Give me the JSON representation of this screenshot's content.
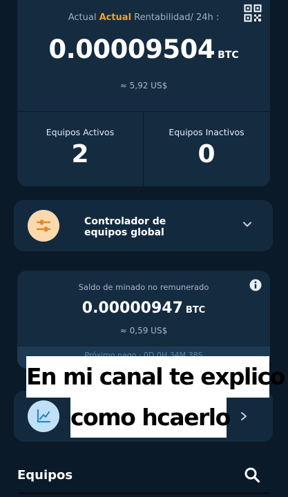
{
  "top": {
    "rent_prefix": "Actual ",
    "rent_accent": "Actual",
    "rent_suffix": " Rentabilidad/ 24h :",
    "balance": "0.00009504",
    "unit": "BTC",
    "usd": "≈ 5,92 US$",
    "active_label": "Equipos Activos",
    "active_count": "2",
    "inactive_label": "Equipos Inactivos",
    "inactive_count": "0"
  },
  "controller": {
    "label": "Controlador de equipos global"
  },
  "mining": {
    "label": "Saldo de minado no remunerado",
    "value": "0.00000947",
    "unit": "BTC",
    "usd": "≈ 0,59 US$",
    "footer": "Próximo pago · 0D 0H 34M 38S"
  },
  "caption": {
    "line1": "En mi canal te explico",
    "line2": "como hcaerlo"
  },
  "bottom": {
    "title": "Equipos"
  },
  "colors": {
    "background": "#0b1a28",
    "card": "#142b40",
    "accent": "#f0a030",
    "controller_icon_bg": "#f9d9ad",
    "chart_icon_bg": "#bfe0f6"
  },
  "icons": [
    "qr-code-icon",
    "sliders-icon",
    "chevron-down-icon",
    "info-icon",
    "chart-line-icon",
    "chevron-right-icon",
    "search-icon"
  ]
}
